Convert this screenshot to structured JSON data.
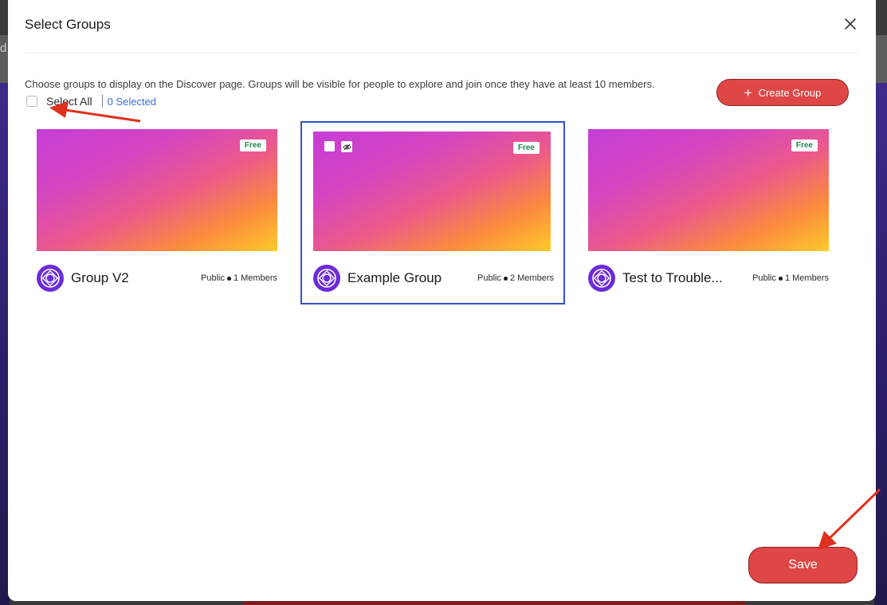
{
  "background": {
    "partial_text": "d"
  },
  "modal": {
    "title": "Select Groups",
    "description": "Choose groups to display on the Discover page. Groups will be visible for people to explore and join once they have at least 10 members.",
    "select_all_label": "Select All",
    "selected_count": "0 Selected",
    "create_button_label": "Create Group",
    "save_button_label": "Save"
  },
  "groups": [
    {
      "name": "Group V2",
      "badge": "Free",
      "visibility": "Public",
      "members": "1 Members",
      "selected": false
    },
    {
      "name": "Example Group",
      "badge": "Free",
      "visibility": "Public",
      "members": "2 Members",
      "selected": true
    },
    {
      "name": "Test to Trouble...",
      "badge": "Free",
      "visibility": "Public",
      "members": "1 Members",
      "selected": false
    }
  ],
  "colors": {
    "accent_red": "#df4747",
    "link_blue": "#3b6fd8",
    "selected_border": "#3452c7",
    "avatar_purple": "#6c2bd9",
    "badge_green": "#1c8c4d",
    "annotation_arrow": "#e0301e"
  },
  "icons": {
    "close": "close-icon",
    "plus": "plus-icon",
    "avatar": "group-logo-icon",
    "hidden": "eye-off-icon"
  }
}
